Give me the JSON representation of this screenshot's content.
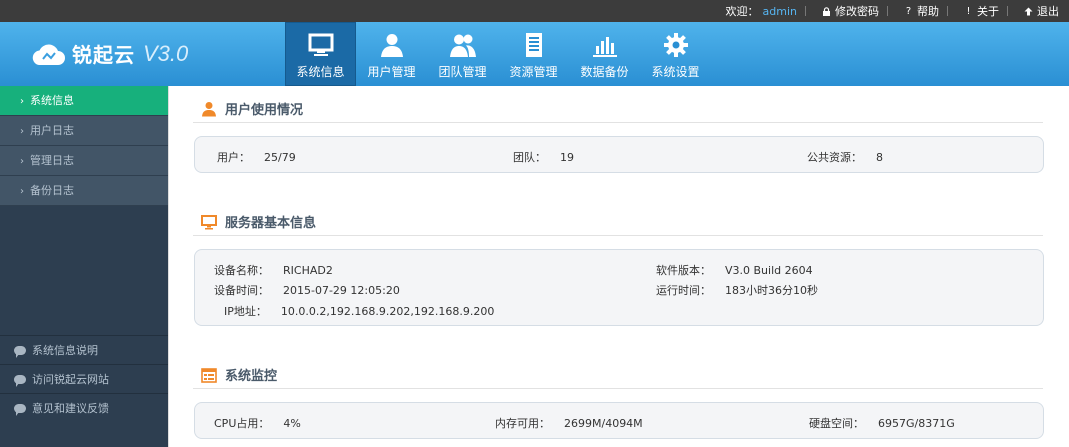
{
  "topbar": {
    "welcome": "欢迎：",
    "user": "admin",
    "change_password": "修改密码",
    "help": "帮助",
    "about": "关于",
    "logout": "退出"
  },
  "logo": {
    "name": "锐起云",
    "version": "V3.0"
  },
  "nav": [
    {
      "label": "系统信息",
      "icon": "monitor-icon",
      "active": true
    },
    {
      "label": "用户管理",
      "icon": "user-icon"
    },
    {
      "label": "团队管理",
      "icon": "team-icon"
    },
    {
      "label": "资源管理",
      "icon": "document-icon"
    },
    {
      "label": "数据备份",
      "icon": "bar-chart-icon"
    },
    {
      "label": "系统设置",
      "icon": "gear-icon"
    }
  ],
  "sidebar": {
    "items": [
      {
        "label": "系统信息",
        "active": true
      },
      {
        "label": "用户日志"
      },
      {
        "label": "管理日志"
      },
      {
        "label": "备份日志"
      }
    ],
    "footer": [
      {
        "label": "系统信息说明"
      },
      {
        "label": "访问锐起云网站"
      },
      {
        "label": "意见和建议反馈"
      }
    ]
  },
  "sections": {
    "usage": {
      "title": "用户使用情况",
      "users_label": "用户：",
      "users_value": "25/79",
      "teams_label": "团队：",
      "teams_value": "19",
      "public_label": "公共资源：",
      "public_value": "8"
    },
    "server": {
      "title": "服务器基本信息",
      "device_name_label": "设备名称：",
      "device_name_value": "RICHAD2",
      "device_time_label": "设备时间：",
      "device_time_value": "2015-07-29 12:05:20",
      "ip_label": "IP地址：",
      "ip_value": "10.0.0.2,192.168.9.202,192.168.9.200",
      "software_label": "软件版本：",
      "software_value": "V3.0 Build 2604",
      "uptime_label": "运行时间：",
      "uptime_value": "183小时36分10秒"
    },
    "monitor": {
      "title": "系统监控",
      "cpu_label": "CPU占用：",
      "cpu_value": "4%",
      "mem_label": "内存可用：",
      "mem_value": "2699M/4094M",
      "disk_label": "硬盘空间：",
      "disk_value": "6957G/8371G"
    }
  },
  "colors": {
    "topbar": "#3c3c3c",
    "header": "#2a8fd3",
    "nav_active": "#1b6aa6",
    "sidebar": "#2d3e50",
    "sidebar_active": "#17b07c",
    "section_icon": "#f0892a"
  }
}
